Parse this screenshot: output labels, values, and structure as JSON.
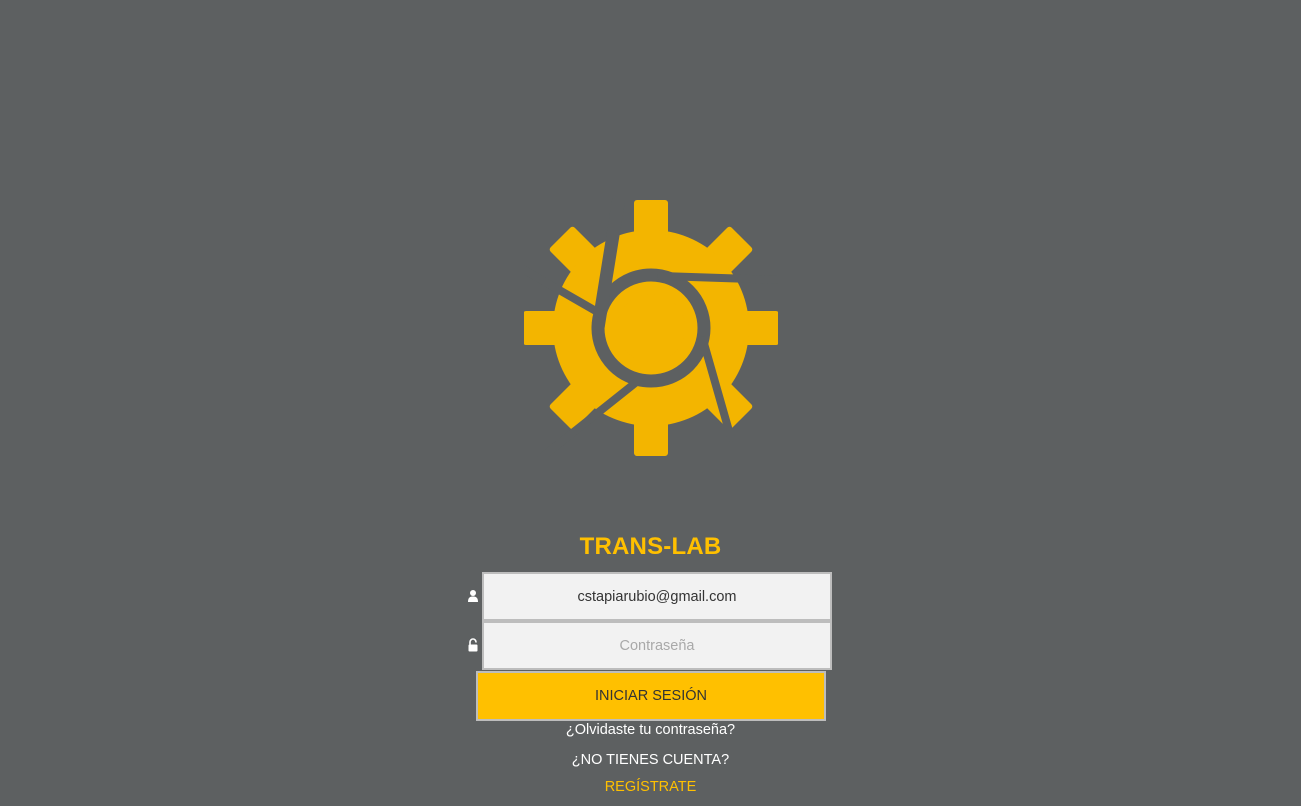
{
  "app": {
    "title": "TRANS-LAB",
    "brand_color": "#ffc000",
    "background_color": "#5d6061"
  },
  "logo": {
    "icon": "gear-logo-icon"
  },
  "login_form": {
    "email": {
      "icon": "user-icon",
      "value": "cstapiarubio@gmail.com",
      "placeholder": ""
    },
    "password": {
      "icon": "unlock-icon",
      "value": "",
      "placeholder": "Contraseña"
    },
    "submit_label": "INICIAR SESIÓN",
    "forgot_password_label": "¿Olvidaste tu contraseña?",
    "no_account_label": "¿NO TIENES CUENTA?",
    "register_label": "REGÍSTRATE"
  }
}
